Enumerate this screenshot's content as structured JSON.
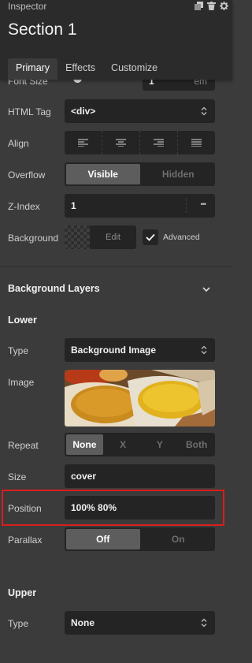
{
  "header": {
    "panel_label": "Inspector",
    "section_title": "Section 1",
    "icons": [
      "copy-icon",
      "trash-icon",
      "gear-icon"
    ],
    "tabs": [
      {
        "label": "Primary",
        "active": true
      },
      {
        "label": "Effects",
        "active": false
      },
      {
        "label": "Customize",
        "active": false
      }
    ]
  },
  "fields": {
    "font_size": {
      "label": "Font Size",
      "value": "1",
      "unit": "em"
    },
    "html_tag": {
      "label": "HTML Tag",
      "value": "<div>"
    },
    "align": {
      "label": "Align"
    },
    "overflow": {
      "label": "Overflow",
      "options": [
        "Visible",
        "Hidden"
      ],
      "selected": "Visible"
    },
    "z_index": {
      "label": "Z-Index",
      "value": "1",
      "more": "•••"
    },
    "background": {
      "label": "Background",
      "edit_label": "Edit",
      "advanced_label": "Advanced",
      "advanced_checked": true
    }
  },
  "background_layers": {
    "title": "Background Layers",
    "lower": {
      "title": "Lower",
      "type": {
        "label": "Type",
        "value": "Background Image"
      },
      "image": {
        "label": "Image"
      },
      "repeat": {
        "label": "Repeat",
        "options": [
          "None",
          "X",
          "Y",
          "Both"
        ],
        "selected": "None"
      },
      "size": {
        "label": "Size",
        "value": "cover"
      },
      "position": {
        "label": "Position",
        "value": "100% 80%"
      },
      "parallax": {
        "label": "Parallax",
        "options": [
          "Off",
          "On"
        ],
        "selected": "Off"
      }
    },
    "upper": {
      "title": "Upper",
      "type": {
        "label": "Type",
        "value": "None"
      }
    }
  },
  "colors": {
    "highlight": "#d91e1e",
    "panel_bg": "#3b3b3b",
    "control_bg": "#242424",
    "header_bg": "#2b2b2b"
  }
}
